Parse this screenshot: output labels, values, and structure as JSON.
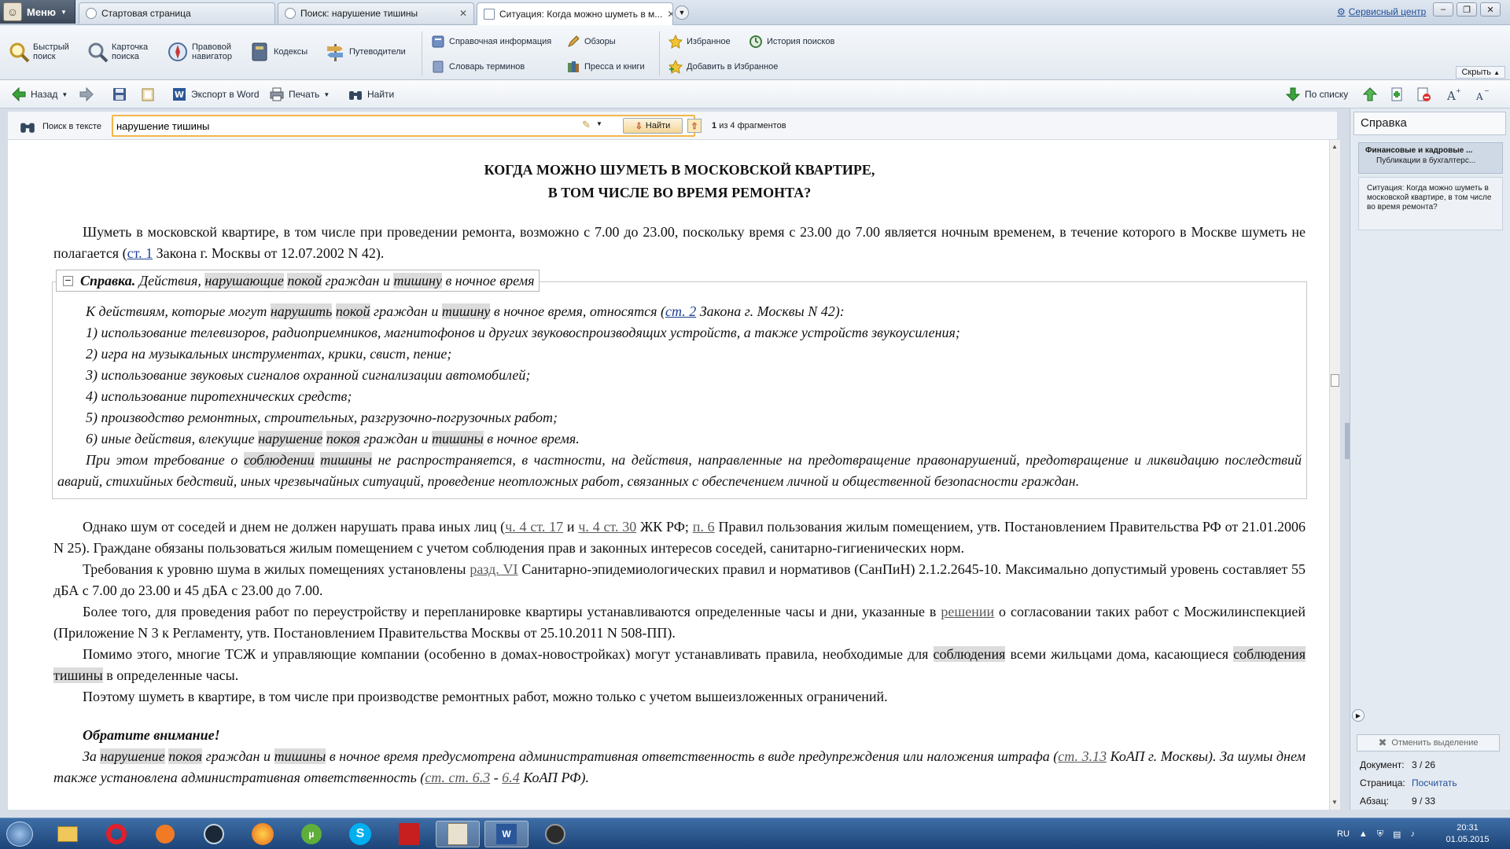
{
  "menu": {
    "label": "Меню"
  },
  "tabs": [
    {
      "label": "Стартовая страница"
    },
    {
      "label": "Поиск: нарушение тишины"
    },
    {
      "label": "Ситуация: Когда можно шуметь в м..."
    }
  ],
  "service_center": "Сервисный центр",
  "ribbon": {
    "quick_search": [
      "Быстрый",
      "поиск"
    ],
    "search_card": [
      "Карточка",
      "поиска"
    ],
    "legal_navigator": [
      "Правовой",
      "навигатор"
    ],
    "codes": "Кодексы",
    "guides": "Путеводители",
    "reference_info": "Справочная информация",
    "term_dictionary": "Словарь терминов",
    "reviews": "Обзоры",
    "press_books": "Пресса и книги",
    "favorites": "Избранное",
    "add_favorites": "Добавить в Избранное",
    "search_history": "История поисков",
    "hide": "Скрыть"
  },
  "toolbar": {
    "back": "Назад",
    "export_word": "Экспорт в Word",
    "print": "Печать",
    "find": "Найти",
    "by_list": "По списку"
  },
  "search": {
    "label": "Поиск в тексте",
    "value": "нарушение тишины",
    "find_button": "Найти",
    "fragment_count_num": "1",
    "fragment_count_text": "из 4 фрагментов"
  },
  "document": {
    "title_line1": "КОГДА МОЖНО ШУМЕТЬ В МОСКОВСКОЙ КВАРТИРЕ,",
    "title_line2": "В ТОМ ЧИСЛЕ ВО ВРЕМЯ РЕМОНТА?",
    "p1_a": "Шуметь в московской квартире, в том числе при проведении ремонта, возможно с 7.00 до 23.00, поскольку время с 23.00 до 7.00 является ночным временем, в течение которого в Москве шуметь не полагается (",
    "p1_link": "ст. 1",
    "p1_b": " Закона г. Москвы от 12.07.2002 N 42).",
    "note_head_bold": "Справка.",
    "note_head_a": " Действия, ",
    "note_head_hl1": "нарушающие",
    "note_head_hl2": "покой",
    "note_head_b": " граждан и ",
    "note_head_hl3": "тишину",
    "note_head_c": " в ночное время",
    "n0_a": "К действиям, которые могут ",
    "n0_hl1": "нарушить",
    "n0_hl2": "покой",
    "n0_b": " граждан и ",
    "n0_hl3": "тишину",
    "n0_c": " в ночное время, относятся (",
    "n0_link": "ст. 2",
    "n0_d": " Закона г. Москвы N 42):",
    "n1": "1) использование телевизоров, радиоприемников, магнитофонов и других звуковоспроизводящих устройств, а также устройств звукоусиления;",
    "n2": "2) игра на музыкальных инструментах, крики, свист, пение;",
    "n3": "3) использование звуковых сигналов охранной сигнализации автомобилей;",
    "n4": "4) использование пиротехнических средств;",
    "n5": "5) производство ремонтных, строительных, разгрузочно-погрузочных работ;",
    "n6_a": "6) иные действия, влекущие ",
    "n6_hl1": "нарушение",
    "n6_hl2": "покоя",
    "n6_b": " граждан и ",
    "n6_hl3": "тишины",
    "n6_c": " в ночное время.",
    "n7_a": "При этом требование о ",
    "n7_hl1": "соблюдении",
    "n7_hl2": "тишины",
    "n7_b": " не распространяется, в частности, на действия, направленные на предотвращение правонарушений, предотвращение и ликвидацию последствий аварий, стихийных бедствий, иных чрезвычайных ситуаций, проведение неотложных работ, связанных с обеспечением личной и общественной безопасности граждан.",
    "p2_a": "Однако шум от соседей и днем не должен нарушать права иных лиц (",
    "p2_link1": "ч. 4 ст. 17",
    "p2_b": " и ",
    "p2_link2": "ч. 4 ст. 30",
    "p2_c": " ЖК РФ; ",
    "p2_link3": "п. 6",
    "p2_d": " Правил пользования жилым помещением, утв. Постановлением Правительства РФ от 21.01.2006 N 25). Граждане обязаны пользоваться жилым помещением с учетом соблюдения прав и законных интересов соседей, санитарно-гигиенических норм.",
    "p3_a": "Требования к уровню шума в жилых помещениях установлены ",
    "p3_link": "разд. VI",
    "p3_b": " Санитарно-эпидемиологических правил и нормативов (СанПиН) 2.1.2.2645-10. Максимально допустимый уровень составляет 55 дБА с 7.00 до 23.00 и 45 дБА с 23.00 до 7.00.",
    "p4_a": "Более того, для проведения работ по переустройству и перепланировке квартиры устанавливаются определенные часы и дни, указанные в ",
    "p4_link": "решении",
    "p4_b": " о согласовании таких работ с Мосжилинспекцией (Приложение N 3 к Регламенту, утв. Постановлением Правительства Москвы от 25.10.2011 N 508-ПП).",
    "p5_a": "Помимо этого, многие ТСЖ и управляющие компании (особенно в домах-новостройках) могут устанавливать правила, необходимые для ",
    "p5_hl1": "соблюдения",
    "p5_b": " всеми жильцами дома, касающиеся ",
    "p5_hl2": "соблюдения",
    "p5_hl3": "тишины",
    "p5_c": " в определенные часы.",
    "p6": "Поэтому шуметь в квартире, в том числе при производстве ремонтных работ, можно только с учетом вышеизложенных ограничений.",
    "attention": "Обратите внимание!",
    "p7_a": "За ",
    "p7_hl1": "нарушение",
    "p7_hl2": "покоя",
    "p7_b": " граждан и ",
    "p7_hl3": "тишины",
    "p7_c": " в ночное время предусмотрена административная ответственность в виде предупреждения или наложения штрафа (",
    "p7_link1": "ст. 3.13",
    "p7_d": " КоАП г. Москвы). За шумы днем также установлена административная ответственность (",
    "p7_link2": "ст. ст. 6.3",
    "p7_e": " - ",
    "p7_link3": "6.4",
    "p7_f": " КоАП РФ)."
  },
  "panel": {
    "title": "Справка",
    "card1_title": "Финансовые и кадровые ...",
    "card1_sub": "Публикации в бухгалтерс...",
    "card2_text": "Ситуация: Когда можно шуметь в московской квартире, в том числе во время ремонта?",
    "deselect": "Отменить выделение",
    "doc_label": "Документ:",
    "doc_value": "3 / 26",
    "page_label": "Страница:",
    "page_value": "Посчитать",
    "para_label": "Абзац:",
    "para_value": "9 / 33"
  },
  "taskbar": {
    "lang": "RU",
    "time": "20:31",
    "date": "01.05.2015"
  }
}
